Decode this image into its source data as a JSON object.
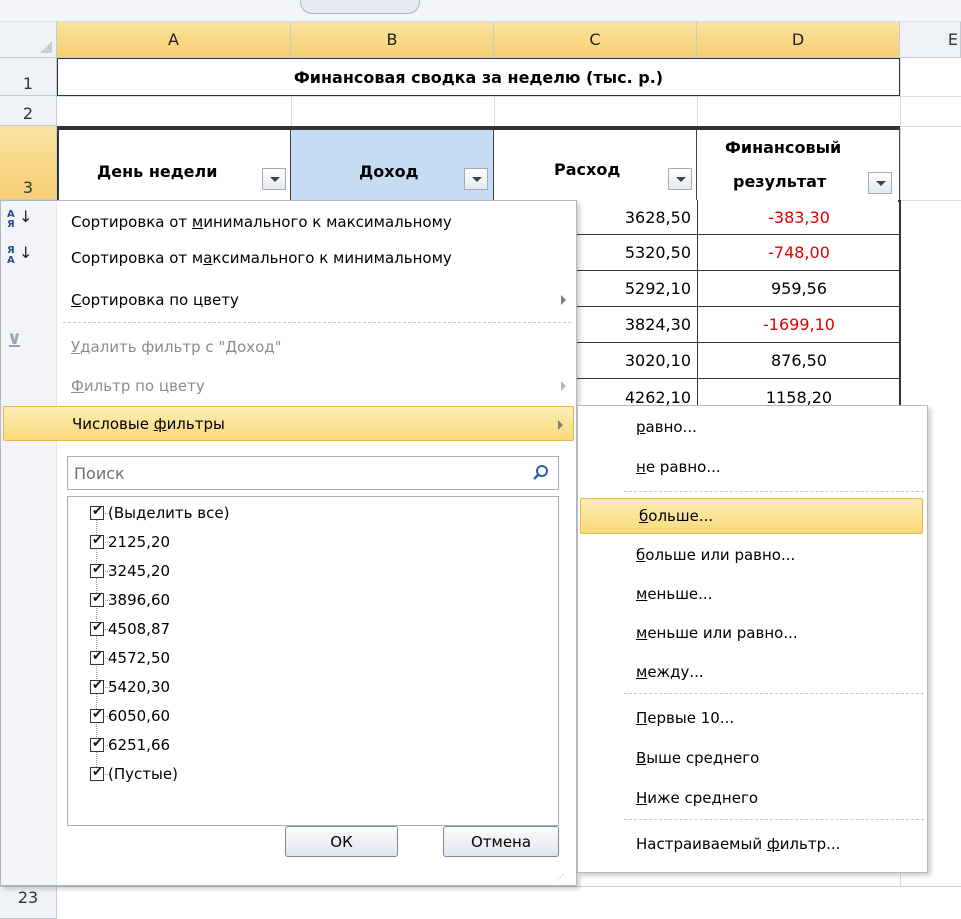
{
  "sheet": {
    "columns": [
      "A",
      "B",
      "C",
      "D",
      "E"
    ],
    "rows": [
      "1",
      "2",
      "3",
      "23"
    ],
    "title": "Финансовая сводка за неделю (тыс. р.)",
    "headers": {
      "day": "День недели",
      "income": "Доход",
      "expense": "Расход",
      "result_line1": "Финансовый",
      "result_line2": "результат"
    },
    "expense_values": [
      "3628,50",
      "5320,50",
      "5292,10",
      "3824,30",
      "3020,10",
      "4262,10"
    ],
    "result_values": [
      "-383,30",
      "-748,00",
      "959,56",
      "-1699,10",
      "876,50",
      "1158,20"
    ],
    "colors": {
      "negative": "#e00000",
      "header_fill": "#c5dcf3",
      "highlight": "#f9d978"
    }
  },
  "menu": {
    "sort_asc": {
      "pre": "Сортировка от ",
      "u": "м",
      "post": "инимального к максимальному"
    },
    "sort_desc": {
      "pre": "Сортировка от м",
      "u": "а",
      "post": "ксимального к минимальному"
    },
    "sort_color": {
      "pre": "",
      "u": "С",
      "post": "ортировка по цвету"
    },
    "clear_filter": {
      "pre": "",
      "u": "У",
      "post": "далить фильтр с \"Доход\""
    },
    "filter_color": {
      "pre": "",
      "u": "Ф",
      "post": "ильтр по цвету"
    },
    "number_filters": {
      "pre": "Числовые ",
      "u": "ф",
      "post": "ильтры"
    },
    "icons": {
      "sort_asc": "sort-ascending-icon",
      "sort_desc": "sort-descending-icon",
      "clear": "clear-filter-icon",
      "search": "search-icon"
    },
    "search_placeholder": "Поиск",
    "list": [
      "(Выделить все)",
      "2125,20",
      "3245,20",
      "3896,60",
      "4508,87",
      "4572,50",
      "5420,30",
      "6050,60",
      "6251,66",
      "(Пустые)"
    ],
    "ok": "ОК",
    "cancel": "Отмена"
  },
  "submenu": {
    "equals": {
      "pre": "",
      "u": "р",
      "post": "авно..."
    },
    "not_equals": {
      "pre": "",
      "u": "н",
      "post": "е равно..."
    },
    "greater": {
      "pre": "",
      "u": "б",
      "post": "ольше..."
    },
    "greater_eq": {
      "pre": "",
      "u": "б",
      "post": "ольше или равно..."
    },
    "less": {
      "pre": "",
      "u": "м",
      "post": "еньше..."
    },
    "less_eq": {
      "pre": "",
      "u": "м",
      "post": "еньше или равно..."
    },
    "between": {
      "pre": "",
      "u": "м",
      "post": "ежду..."
    },
    "top10": {
      "pre": "",
      "u": "П",
      "post": "ервые 10..."
    },
    "above_avg": {
      "pre": "",
      "u": "В",
      "post": "ыше среднего"
    },
    "below_avg": {
      "pre": "",
      "u": "Н",
      "post": "иже среднего"
    },
    "custom": {
      "pre": "Настраиваемый ",
      "u": "ф",
      "post": "ильтр..."
    }
  }
}
